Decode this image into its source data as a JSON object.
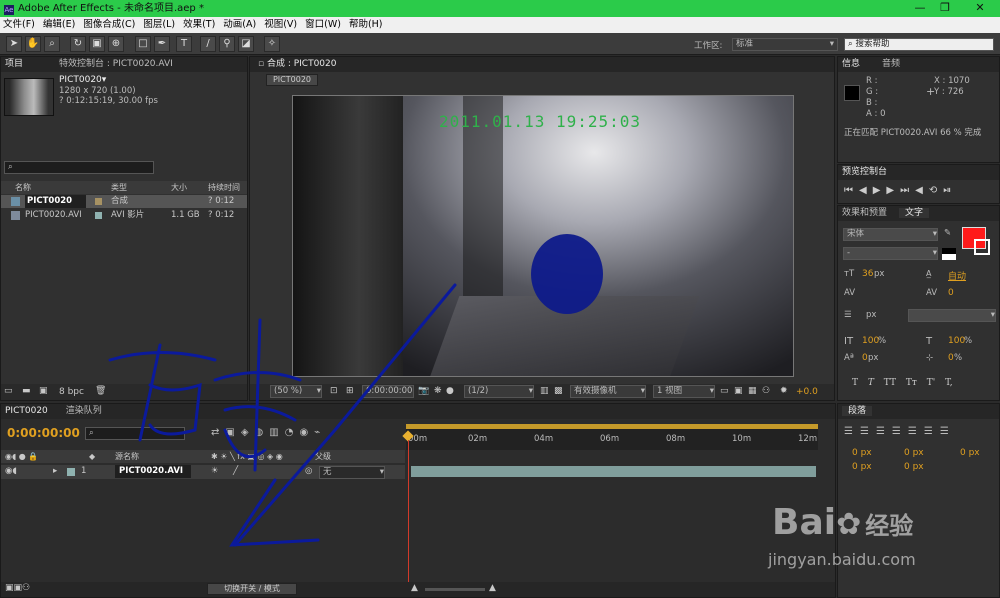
{
  "window": {
    "title": "Adobe After Effects - 未命名项目.aep *",
    "logo": "Ae"
  },
  "menu": [
    "文件(F)",
    "编辑(E)",
    "图像合成(C)",
    "图层(L)",
    "效果(T)",
    "动画(A)",
    "视图(V)",
    "窗口(W)",
    "帮助(H)"
  ],
  "toolbar": {
    "workspace_label": "工作区:",
    "workspace_value": "标准",
    "search_placeholder": "搜索帮助"
  },
  "project": {
    "tabs": [
      "项目",
      "特效控制台 : PICT0020.AVI"
    ],
    "item_name": "PICT0020▾",
    "item_info1": "1280 x 720 (1.00)",
    "item_info2": "? 0:12:15:19, 30.00 fps",
    "columns": [
      "名称",
      "类型",
      "大小",
      "持续时间"
    ],
    "rows": [
      {
        "name": "PICT0020",
        "type": "合成",
        "size": "",
        "duration": "? 0:12"
      },
      {
        "name": "PICT0020.AVI",
        "type": "AVI 影片",
        "size": "1.1 GB",
        "duration": "? 0:12"
      }
    ],
    "bpc": "8 bpc"
  },
  "composition": {
    "tab": "合成 : PICT0020",
    "chip": "PICT0020",
    "timestamp": "2011.01.13 19:25:03",
    "zoom": "(50 %)",
    "time": "0:00:00:00",
    "resolution": "(1/2)",
    "camera": "有效摄像机",
    "view": "1 视图",
    "offset": "+0.0"
  },
  "info": {
    "tabs": [
      "信息",
      "音频"
    ],
    "r": "R :",
    "g": "G :",
    "b": "B :",
    "a": "A : 0",
    "x": "X : 1070",
    "y": "Y : 726",
    "status": "正在匹配 PICT0020.AVI 66 % 完成"
  },
  "preview": {
    "tab": "预览控制台"
  },
  "text_panel": {
    "tabs": [
      "效果和预置",
      "文字"
    ],
    "font": "宋体",
    "style": "-",
    "size": "36",
    "size_unit": "px",
    "leading": "自动",
    "kerning": "",
    "tracking": "0",
    "stroke": "",
    "stroke_unit": "px",
    "scale_v": "100",
    "scale_h": "100",
    "pct": "%",
    "baseline": "0",
    "baseline_unit": "px",
    "tsume": "0",
    "tsume_unit": "%",
    "type_buttons": [
      "T",
      "T",
      "TT",
      "Tт",
      "T'",
      "T,"
    ],
    "fill_color": "#ff1a1a"
  },
  "paragraph": {
    "tab": "段落",
    "indent_values": [
      "0 px",
      "0 px",
      "0 px",
      "0 px",
      "0 px"
    ]
  },
  "timeline": {
    "tabs": [
      "PICT0020",
      "渲染队列"
    ],
    "time": "0:00:00:00",
    "ruler": [
      "00m",
      "02m",
      "04m",
      "06m",
      "08m",
      "10m",
      "12m"
    ],
    "col_source": "源名称",
    "col_parent": "父级",
    "layer_num": "1",
    "layer_name": "PICT0020.AVI",
    "layer_parent": "无",
    "footer": "切换开关 / 模式"
  },
  "watermark": {
    "brand": "Bai",
    "brand2": "经验",
    "url": "jingyan.baidu.com"
  },
  "annotation": {
    "text": "右击"
  }
}
